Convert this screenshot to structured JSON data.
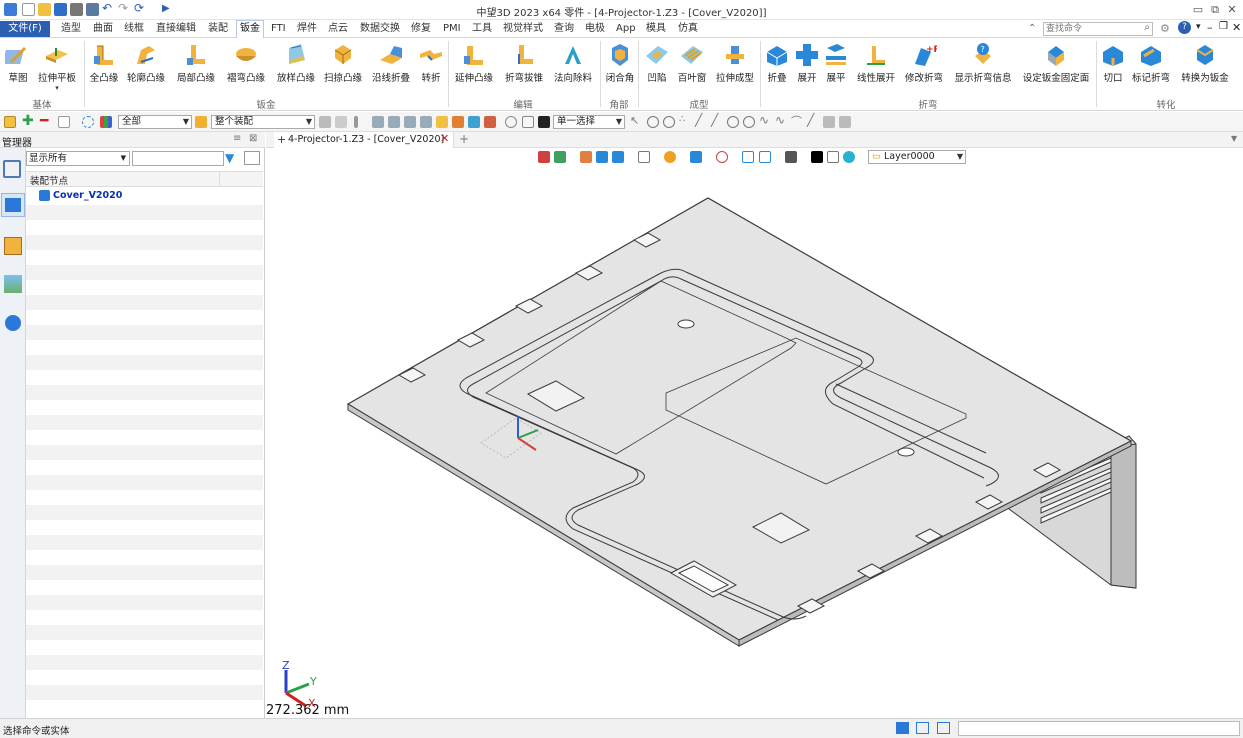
{
  "window": {
    "title": "中望3D 2023 x64     零件 - [4-Projector-1.Z3 - [Cover_V2020]]"
  },
  "menubar": {
    "items": [
      "文件(F)",
      "造型",
      "曲面",
      "线框",
      "直接编辑",
      "装配",
      "钣金",
      "FTI",
      "焊件",
      "点云",
      "数据交换",
      "修复",
      "PMI",
      "工具",
      "视觉样式",
      "查询",
      "电极",
      "App",
      "模具",
      "仿真"
    ],
    "active": "钣金",
    "search_placeholder": "查找命令"
  },
  "ribbon": {
    "buttons": [
      {
        "label": "草图",
        "icon": "sketch-icon"
      },
      {
        "label": "拉伸平板",
        "icon": "extrude-plate-icon"
      },
      {
        "label": "全凸缘",
        "icon": "full-flange-icon"
      },
      {
        "label": "轮廓凸缘",
        "icon": "profile-flange-icon"
      },
      {
        "label": "局部凸缘",
        "icon": "partial-flange-icon"
      },
      {
        "label": "褶弯凸缘",
        "icon": "hem-flange-icon"
      },
      {
        "label": "放样凸缘",
        "icon": "loft-flange-icon"
      },
      {
        "label": "扫掠凸缘",
        "icon": "sweep-flange-icon"
      },
      {
        "label": "沿线折叠",
        "icon": "fold-along-line-icon"
      },
      {
        "label": "转折",
        "icon": "jog-icon"
      },
      {
        "label": "延伸凸缘",
        "icon": "extend-flange-icon"
      },
      {
        "label": "折弯拔锥",
        "icon": "bend-taper-icon"
      },
      {
        "label": "法向除料",
        "icon": "normal-cut-icon"
      },
      {
        "label": "闭合角",
        "icon": "close-corner-icon"
      },
      {
        "label": "凹陷",
        "icon": "dimple-icon"
      },
      {
        "label": "百叶窗",
        "icon": "louver-icon"
      },
      {
        "label": "拉伸成型",
        "icon": "stretch-form-icon"
      },
      {
        "label": "折叠",
        "icon": "fold-icon"
      },
      {
        "label": "展开",
        "icon": "unfold-icon"
      },
      {
        "label": "展平",
        "icon": "flatten-icon"
      },
      {
        "label": "线性展开",
        "icon": "linear-unfold-icon"
      },
      {
        "label": "修改折弯",
        "icon": "modify-bend-icon"
      },
      {
        "label": "显示折弯信息",
        "icon": "bend-info-icon"
      },
      {
        "label": "设定钣金固定面",
        "icon": "fixed-face-icon"
      },
      {
        "label": "切口",
        "icon": "rip-icon"
      },
      {
        "label": "标记折弯",
        "icon": "mark-bend-icon"
      },
      {
        "label": "转换为钣金",
        "icon": "convert-sheetmetal-icon"
      }
    ],
    "groups": [
      "基体",
      "钣金",
      "编辑",
      "角部",
      "成型",
      "折弯",
      "转化"
    ]
  },
  "toolbar2": {
    "filter_value": "全部",
    "assembly_value": "整个装配",
    "select_mode": "单一选择"
  },
  "manager": {
    "header": "管理器",
    "show_filter": "显示所有",
    "column_header": "装配节点",
    "root_node": "Cover_V2020"
  },
  "document_tab": {
    "label": "4-Projector-1.Z3 - [Cover_V2020]"
  },
  "view_toolbar": {
    "layer": "Layer0000"
  },
  "viewport": {
    "scale_readout": "272.362 mm",
    "axis_labels": {
      "z": "Z",
      "y": "Y",
      "x": "X"
    }
  },
  "status": {
    "prompt": "选择命令或实体"
  },
  "colors": {
    "accent": "#2b5fb4",
    "part_face": "#e4e4e4",
    "part_edge": "#3a3a3a"
  }
}
